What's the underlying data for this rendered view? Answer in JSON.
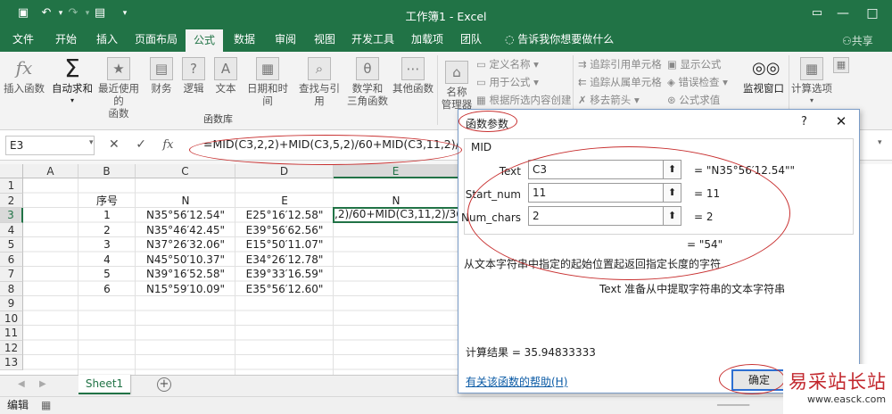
{
  "window": {
    "title": "工作簿1 - Excel",
    "share": "共享"
  },
  "ribbon": {
    "tabs": [
      "文件",
      "开始",
      "插入",
      "页面布局",
      "公式",
      "数据",
      "审阅",
      "视图",
      "开发工具",
      "加载项",
      "团队"
    ],
    "active_tab": "公式",
    "tell_me": "告诉我你想要做什么",
    "buttons": {
      "insert_function": "插入函数",
      "autosum": "自动求和",
      "recent_1": "最近使用的",
      "recent_2": "函数",
      "financial": "财务",
      "logical": "逻辑",
      "text": "文本",
      "datetime": "日期和时间",
      "lookup": "查找与引用",
      "math_1": "数学和",
      "math_2": "三角函数",
      "more": "其他函数",
      "name_mgr_1": "名称",
      "name_mgr_2": "管理器",
      "define_name": "定义名称",
      "use_in_formula": "用于公式",
      "create_from_sel": "根据所选内容创建",
      "trace_precedents": "追踪引用单元格",
      "trace_dependents": "追踪从属单元格",
      "remove_arrows": "移去箭头",
      "show_formulas": "显示公式",
      "error_check": "错误检查",
      "evaluate": "公式求值",
      "watch": "监视窗口",
      "calc_options": "计算选项"
    },
    "group_label": "函数库"
  },
  "formula_bar": {
    "name_box": "E3",
    "formula": "=MID(C3,2,2)+MID(C3,5,2)/60+MID(C3,11,2)/3600"
  },
  "grid": {
    "columns": [
      "A",
      "B",
      "C",
      "D",
      "E"
    ],
    "rows": [
      "1",
      "2",
      "3",
      "4",
      "5",
      "6",
      "7",
      "8",
      "9",
      "10",
      "11",
      "12",
      "13"
    ],
    "headers_row2": {
      "B": "序号",
      "C": "N",
      "D": "E",
      "E": "N"
    },
    "data": [
      {
        "B": "1",
        "C": "N35°56′12.54\"",
        "D": "E25°16′12.58\"",
        "E": ",2)/60+MID(C3,11,2)/3600"
      },
      {
        "B": "2",
        "C": "N35°46′42.45\"",
        "D": "E39°56′62.56\""
      },
      {
        "B": "3",
        "C": "N37°26′32.06\"",
        "D": "E15°50′11.07\""
      },
      {
        "B": "4",
        "C": "N45°50′10.37\"",
        "D": "E34°26′12.78\""
      },
      {
        "B": "5",
        "C": "N39°16′52.58\"",
        "D": "E39°33′16.59\""
      },
      {
        "B": "6",
        "C": "N15°59′10.09\"",
        "D": "E35°56′12.60\""
      }
    ],
    "sheet_tab": "Sheet1",
    "status": "编辑"
  },
  "dialog": {
    "title": "函数参数",
    "function_name": "MID",
    "args": [
      {
        "label": "Text",
        "value": "C3",
        "result": "\"N35°56′12.54\"\""
      },
      {
        "label": "Start_num",
        "value": "11",
        "result": "11"
      },
      {
        "label": "Num_chars",
        "value": "2",
        "result": "2"
      }
    ],
    "overall_result": "= \"54\"",
    "description": "从文本字符串中指定的起始位置起返回指定长度的字符",
    "arg_description": "Text  准备从中提取字符串的文本字符串",
    "calc_result": "计算结果 =  35.94833333",
    "help_link": "有关该函数的帮助(H)",
    "ok": "确定"
  },
  "watermark": {
    "text": "易采站长站",
    "url": "www.easck.com"
  }
}
